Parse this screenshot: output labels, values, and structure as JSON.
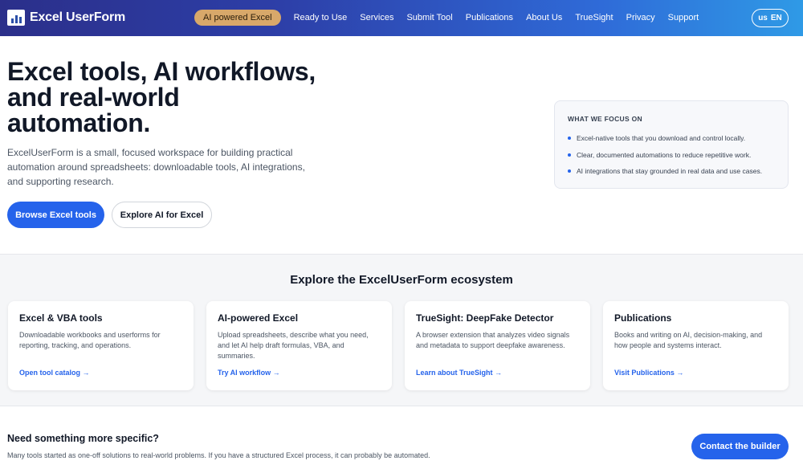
{
  "header": {
    "logo_text": "Excel UserForm",
    "nav_pill": "AI powered Excel",
    "nav": [
      "Ready to Use",
      "Services",
      "Submit Tool",
      "Publications",
      "About Us",
      "TrueSight",
      "Privacy",
      "Support"
    ],
    "lang_flag": "us",
    "lang_code": "EN"
  },
  "hero": {
    "title_lines": [
      "Excel tools, AI workflows,",
      "and real-world",
      "automation."
    ],
    "description": "ExcelUserForm is a small, focused workspace for building practical automation around spreadsheets: downloadable tools, AI integrations, and supporting research.",
    "primary_button": "Browse Excel tools",
    "secondary_button": "Explore AI for Excel"
  },
  "focus": {
    "title": "WHAT WE FOCUS ON",
    "items": [
      "Excel-native tools that you download and control locally.",
      "Clear, documented automations to reduce repetitive work.",
      "AI integrations that stay grounded in real data and use cases."
    ]
  },
  "ecosystem": {
    "title": "Explore the ExcelUserForm ecosystem",
    "cards": [
      {
        "title": "Excel & VBA tools",
        "description": "Downloadable workbooks and userforms for reporting, tracking, and operations.",
        "link": "Open tool catalog →"
      },
      {
        "title": "AI-powered Excel",
        "description": "Upload spreadsheets, describe what you need, and let AI help draft formulas, VBA, and summaries.",
        "link": "Try AI workflow →"
      },
      {
        "title": "TrueSight: DeepFake Detector",
        "description": "A browser extension that analyzes video signals and metadata to support deepfake awareness.",
        "link": "Learn about TrueSight →"
      },
      {
        "title": "Publications",
        "description": "Books and writing on AI, decision-making, and how people and systems interact.",
        "link": "Visit Publications →"
      }
    ]
  },
  "cta": {
    "title": "Need something more specific?",
    "description": "Many tools started as one-off solutions to real-world problems. If you have a structured Excel process, it can probably be automated.",
    "button": "Contact the builder"
  },
  "colors": {
    "accent": "#2563eb",
    "nav_pill": "#d8a86a",
    "header_start": "#2b2f8a",
    "header_end": "#2f9ae6"
  }
}
